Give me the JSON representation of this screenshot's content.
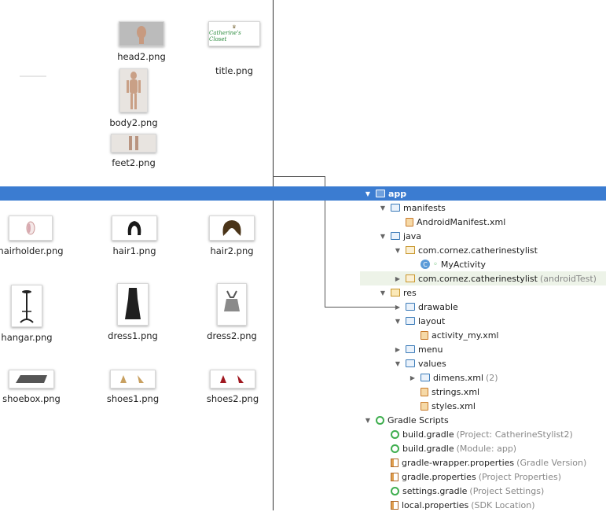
{
  "files": [
    {
      "name": "head2.png"
    },
    {
      "name": "title.png",
      "thumb_text": "Catherine's Closet"
    },
    {
      "name": "body2.png"
    },
    {
      "name": "feet2.png"
    },
    {
      "name": "hairholder.png"
    },
    {
      "name": "hair1.png"
    },
    {
      "name": "hair2.png"
    },
    {
      "name": "hangar.png"
    },
    {
      "name": "dress1.png"
    },
    {
      "name": "dress2.png"
    },
    {
      "name": "shoebox.png"
    },
    {
      "name": "shoes1.png"
    },
    {
      "name": "shoes2.png"
    }
  ],
  "tree": [
    {
      "label": "app",
      "hint": "",
      "icon": "folder-icon",
      "expanded": true,
      "selected": true
    },
    {
      "label": "manifests",
      "hint": "",
      "icon": "folder-icon",
      "expanded": true
    },
    {
      "label": "AndroidManifest.xml",
      "hint": "",
      "icon": "xml-file-icon"
    },
    {
      "label": "java",
      "hint": "",
      "icon": "folder-icon",
      "expanded": true
    },
    {
      "label": "com.cornez.catherinestylist",
      "hint": "",
      "icon": "package-icon",
      "expanded": true
    },
    {
      "label": "MyActivity",
      "hint": "",
      "icon": "class-icon"
    },
    {
      "label": "com.cornez.catherinestylist",
      "hint": "(androidTest)",
      "icon": "package-icon",
      "expanded": false
    },
    {
      "label": "res",
      "hint": "",
      "icon": "res-folder-icon",
      "expanded": true
    },
    {
      "label": "drawable",
      "hint": "",
      "icon": "folder-icon",
      "expanded": false
    },
    {
      "label": "layout",
      "hint": "",
      "icon": "folder-icon",
      "expanded": true
    },
    {
      "label": "activity_my.xml",
      "hint": "",
      "icon": "xml-file-icon"
    },
    {
      "label": "menu",
      "hint": "",
      "icon": "folder-icon",
      "expanded": false
    },
    {
      "label": "values",
      "hint": "",
      "icon": "folder-icon",
      "expanded": true
    },
    {
      "label": "dimens.xml",
      "hint": "(2)",
      "icon": "folder-icon",
      "expanded": false
    },
    {
      "label": "strings.xml",
      "hint": "",
      "icon": "xml-file-icon"
    },
    {
      "label": "styles.xml",
      "hint": "",
      "icon": "xml-file-icon"
    },
    {
      "label": "Gradle Scripts",
      "hint": "",
      "icon": "gradle-icon",
      "expanded": true
    },
    {
      "label": "build.gradle",
      "hint": "(Project: CatherineStylist2)",
      "icon": "gradle-icon"
    },
    {
      "label": "build.gradle",
      "hint": "(Module: app)",
      "icon": "gradle-icon"
    },
    {
      "label": "gradle-wrapper.properties",
      "hint": "(Gradle Version)",
      "icon": "properties-icon"
    },
    {
      "label": "gradle.properties",
      "hint": "(Project Properties)",
      "icon": "properties-icon"
    },
    {
      "label": "settings.gradle",
      "hint": "(Project Settings)",
      "icon": "gradle-icon"
    },
    {
      "label": "local.properties",
      "hint": "(SDK Location)",
      "icon": "properties-icon"
    }
  ]
}
